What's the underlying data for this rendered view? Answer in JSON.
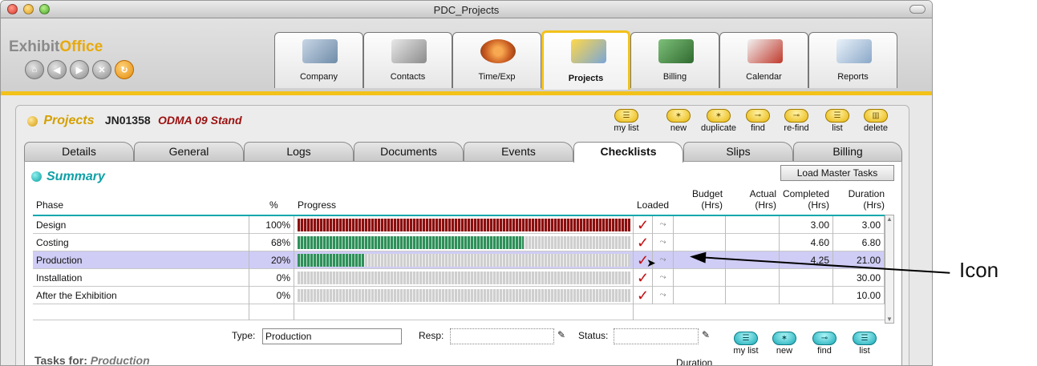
{
  "window": {
    "title": "PDC_Projects"
  },
  "header": {
    "logo_part1": "Exhibit",
    "logo_part2": "Office",
    "nav_buttons": [
      "home",
      "back",
      "forward",
      "cancel",
      "refresh"
    ],
    "nav_glyphs": [
      "⌂",
      "◀",
      "▶",
      "✕",
      "↻"
    ],
    "modules": [
      {
        "label": "Company",
        "icon": "company-building-icon"
      },
      {
        "label": "Contacts",
        "icon": "contacts-phone-icon"
      },
      {
        "label": "Time/Exp",
        "icon": "time-clock-icon"
      },
      {
        "label": "Projects",
        "icon": "projects-icon",
        "active": true
      },
      {
        "label": "Billing",
        "icon": "billing-money-icon"
      },
      {
        "label": "Calendar",
        "icon": "calendar-icon"
      },
      {
        "label": "Reports",
        "icon": "reports-icon"
      }
    ]
  },
  "project": {
    "section_label": "Projects",
    "job_number": "JN01358",
    "name": "ODMA 09 Stand"
  },
  "toolbar": {
    "my_list": "my list",
    "new": "new",
    "duplicate": "duplicate",
    "find": "find",
    "refind": "re-find",
    "list": "list",
    "delete": "delete"
  },
  "subtabs": [
    "Details",
    "General",
    "Logs",
    "Documents",
    "Events",
    "Checklists",
    "Slips",
    "Billing"
  ],
  "active_subtab": "Checklists",
  "summary": {
    "title": "Summary",
    "load_master_tasks": "Load Master Tasks",
    "columns": {
      "phase": "Phase",
      "pct": "%",
      "progress": "Progress",
      "loaded": "Loaded",
      "budget": "Budget (Hrs)",
      "budget_l1": "Budget",
      "budget_l2": "(Hrs)",
      "actual_l1": "Actual",
      "actual_l2": "(Hrs)",
      "completed_l1": "Completed",
      "completed_l2": "(Hrs)",
      "duration_l1": "Duration",
      "duration_l2": "(Hrs)"
    },
    "rows": [
      {
        "phase": "Design",
        "pct": "100%",
        "progress": 1.0,
        "color": "red",
        "loaded": "✓",
        "budget": "",
        "actual": "",
        "completed": "3.00",
        "duration": "3.00"
      },
      {
        "phase": "Costing",
        "pct": "68%",
        "progress": 0.68,
        "color": "green",
        "loaded": "✓",
        "budget": "",
        "actual": "",
        "completed": "4.60",
        "duration": "6.80"
      },
      {
        "phase": "Production",
        "pct": "20%",
        "progress": 0.2,
        "color": "green",
        "loaded": "✓",
        "budget": "",
        "actual": "",
        "completed": "4.25",
        "duration": "21.00",
        "selected": true
      },
      {
        "phase": "Installation",
        "pct": "0%",
        "progress": 0,
        "color": "green",
        "loaded": "✓",
        "budget": "",
        "actual": "",
        "completed": "",
        "duration": "30.00"
      },
      {
        "phase": "After the Exhibition",
        "pct": "0%",
        "progress": 0,
        "color": "green",
        "loaded": "✓",
        "budget": "",
        "actual": "",
        "completed": "",
        "duration": "10.00"
      }
    ]
  },
  "tasks": {
    "type_label": "Type:",
    "type_value": "Production",
    "resp_label": "Resp:",
    "resp_value": "",
    "status_label": "Status:",
    "status_value": "",
    "duration_label": "Duration",
    "tasks_for_label": "Tasks for:",
    "tasks_for_value": "Production",
    "buttons": {
      "my_list": "my list",
      "new": "new",
      "find": "find",
      "list": "list"
    }
  },
  "annotation": {
    "label": "Icon"
  },
  "colors": {
    "accent": "#f2c21a",
    "teal": "#0ea0a6",
    "project_name": "#9b1010",
    "selected_row": "#cfcdf5"
  }
}
